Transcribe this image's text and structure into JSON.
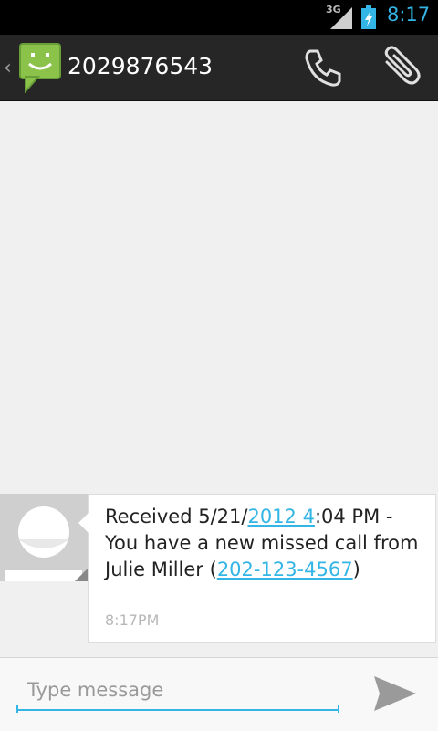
{
  "status_bar": {
    "network": "3G",
    "time": "8:17",
    "battery_level": 0.8
  },
  "action_bar": {
    "contact_number": "2029876543",
    "icons": {
      "back": "chevron-left-icon",
      "app": "messaging-smiley-icon",
      "call": "phone-icon",
      "attach": "paperclip-icon"
    }
  },
  "conversation": {
    "messages": [
      {
        "text_parts": [
          "Received 5/21/",
          "2012 4",
          ":04 PM - You have a new missed call from Julie Miller (",
          "202-123-4567",
          ")"
        ],
        "time": "8:17PM"
      }
    ]
  },
  "compose": {
    "placeholder": "Type message",
    "value": ""
  },
  "colors": {
    "accent": "#33b5e5",
    "action_bar": "#262626",
    "status_bar": "#000000",
    "background": "#f0f0f0"
  }
}
